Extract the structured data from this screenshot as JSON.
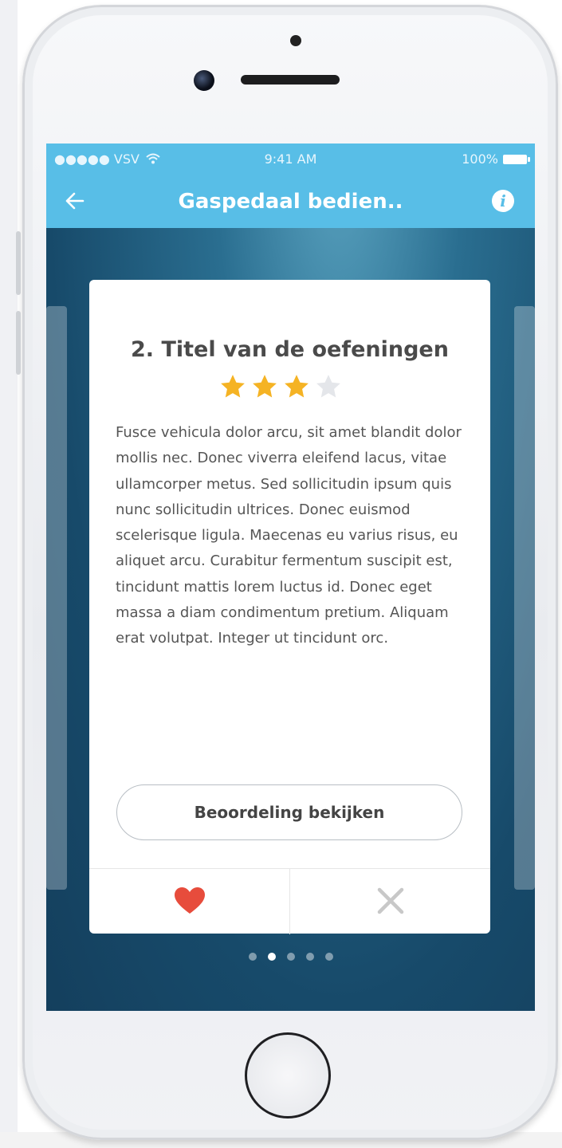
{
  "status_bar": {
    "carrier": "●●●●● VSV",
    "wifi_icon": "wifi-icon",
    "time": "9:41 AM",
    "battery": "100%"
  },
  "nav": {
    "back_icon": "arrow-left-icon",
    "title": "Gaspedaal bedien..",
    "info_icon": "info-icon",
    "info_glyph": "i"
  },
  "card": {
    "title": "2. Titel van de oefeningen",
    "rating": 3,
    "rating_max": 5,
    "rating_shown_max": 4,
    "body": "Fusce vehicula dolor arcu, sit amet blandit dolor mollis nec. Donec viverra eleifend lacus, vitae ullamcorper metus. Sed sollicitudin ipsum quis nunc sollicitudin ultrices. Donec euismod scelerisque ligula. Maecenas eu varius risus, eu aliquet arcu. Curabitur fermentum suscipit est, tincidunt mattis lorem luctus id. Donec eget massa a diam condimentum pretium. Aliquam erat volutpat. Integer ut tincidunt orc.",
    "review_button": "Beoordeling bekijken",
    "like_icon": "heart-icon",
    "dismiss_icon": "close-icon"
  },
  "pagination": {
    "total": 5,
    "active": 1
  },
  "colors": {
    "accent": "#58bee7",
    "star_on": "#f5b324",
    "star_off": "#e4e6ea",
    "heart": "#e74c3c",
    "close": "#c8c8c8"
  }
}
